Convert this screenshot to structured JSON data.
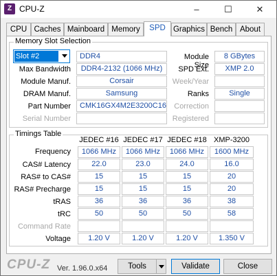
{
  "window": {
    "title": "CPU-Z",
    "app_icon": "cpu-z-icon",
    "controls": {
      "minimize": "–",
      "maximize": "☐",
      "close": "✕"
    }
  },
  "tabs": [
    "CPU",
    "Caches",
    "Mainboard",
    "Memory",
    "SPD",
    "Graphics",
    "Bench",
    "About"
  ],
  "active_tab": "SPD",
  "memory_slot": {
    "group_title": "Memory Slot Selection",
    "slot_selected": "Slot #2",
    "type": "DDR4",
    "module_size_label": "Module Size",
    "module_size": "8 GBytes",
    "max_bandwidth_label": "Max Bandwidth",
    "max_bandwidth": "DDR4-2132 (1066 MHz)",
    "spd_ext_label": "SPD Ext.",
    "spd_ext": "XMP 2.0",
    "module_manuf_label": "Module Manuf.",
    "module_manuf": "Corsair",
    "week_year_label": "Week/Year",
    "week_year": "",
    "dram_manuf_label": "DRAM Manuf.",
    "dram_manuf": "Samsung",
    "ranks_label": "Ranks",
    "ranks": "Single",
    "part_number_label": "Part Number",
    "part_number": "CMK16GX4M2E3200C16",
    "correction_label": "Correction",
    "correction": "",
    "serial_number_label": "Serial Number",
    "serial_number": "",
    "registered_label": "Registered",
    "registered": ""
  },
  "timings": {
    "group_title": "Timings Table",
    "columns": [
      "JEDEC #16",
      "JEDEC #17",
      "JEDEC #18",
      "XMP-3200"
    ],
    "rows": [
      {
        "label": "Frequency",
        "values": [
          "1066 MHz",
          "1066 MHz",
          "1066 MHz",
          "1600 MHz"
        ]
      },
      {
        "label": "CAS# Latency",
        "values": [
          "22.0",
          "23.0",
          "24.0",
          "16.0"
        ]
      },
      {
        "label": "RAS# to CAS#",
        "values": [
          "15",
          "15",
          "15",
          "20"
        ]
      },
      {
        "label": "RAS# Precharge",
        "values": [
          "15",
          "15",
          "15",
          "20"
        ]
      },
      {
        "label": "tRAS",
        "values": [
          "36",
          "36",
          "36",
          "38"
        ]
      },
      {
        "label": "tRC",
        "values": [
          "50",
          "50",
          "50",
          "58"
        ]
      },
      {
        "label": "Command Rate",
        "values": [
          "",
          "",
          "",
          ""
        ]
      },
      {
        "label": "Voltage",
        "values": [
          "1.20 V",
          "1.20 V",
          "1.20 V",
          "1.350 V"
        ]
      }
    ]
  },
  "footer": {
    "logo": "CPU-Z",
    "version": "Ver. 1.96.0.x64",
    "tools_label": "Tools",
    "validate_label": "Validate",
    "close_label": "Close"
  }
}
